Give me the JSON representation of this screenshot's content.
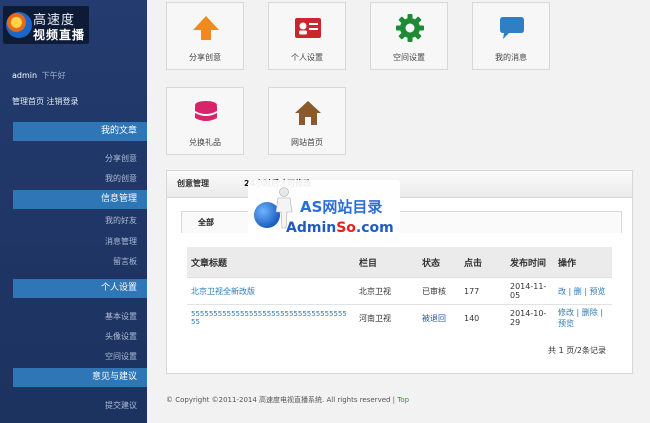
{
  "brand": {
    "line1": "高速度",
    "line2": "视频直播"
  },
  "user": {
    "name": "admin",
    "greeting": "下午好"
  },
  "top_links": {
    "admin_home": "管理首页",
    "logout": "注销登录"
  },
  "sidebar": {
    "sections": [
      {
        "title": "我的文章",
        "items": [
          "分享创意",
          "我的创意"
        ]
      },
      {
        "title": "信息管理",
        "items": [
          "我的好友",
          "消息管理",
          "留言板"
        ]
      },
      {
        "title": "个人设置",
        "items": [
          "基本设置",
          "头像设置",
          "空间设置"
        ]
      },
      {
        "title": "意见与建议",
        "items": [
          "提交建议"
        ]
      }
    ]
  },
  "tiles": [
    {
      "label": "分享创意",
      "icon": "arrow-up-icon",
      "color": "#f08a1c"
    },
    {
      "label": "个人设置",
      "icon": "id-card-icon",
      "color": "#c8272d"
    },
    {
      "label": "空间设置",
      "icon": "gear-icon",
      "color": "#1f8a35"
    },
    {
      "label": "我的消息",
      "icon": "chat-bubble-icon",
      "color": "#2f7fc4"
    },
    {
      "label": "兑换礼品",
      "icon": "database-icon",
      "color": "#d8246b"
    },
    {
      "label": "网站首页",
      "icon": "house-icon",
      "color": "#8a5a2c"
    }
  ],
  "panel": {
    "title": "创意管理",
    "notice": "24小时后才可修改",
    "tab": "全部",
    "columns": [
      "文章标题",
      "栏目",
      "状态",
      "点击",
      "发布时间",
      "操作"
    ],
    "rows": [
      {
        "title": "北京卫视全新改版",
        "category": "北京卫视",
        "status": "已审核",
        "clicks": "177",
        "date": "2014-11-05",
        "actions": "改 | 删 | 预览"
      },
      {
        "title": "5555555555555555555555555555555555555",
        "category": "河南卫视",
        "status": "被退回",
        "clicks": "140",
        "date": "2014-10-29",
        "actions": "修改 | 删除 | 预览"
      }
    ],
    "pager": "共 1 页/2条记录"
  },
  "footer": {
    "text": "© Copyright ©2011-2014 高速度电视直播系统. All rights reserved |",
    "top_link": "Top"
  },
  "watermark": {
    "line1": "AS网站目录",
    "line2_blue": "Admin",
    "line2_red": "So",
    "line2_end": ".com"
  }
}
